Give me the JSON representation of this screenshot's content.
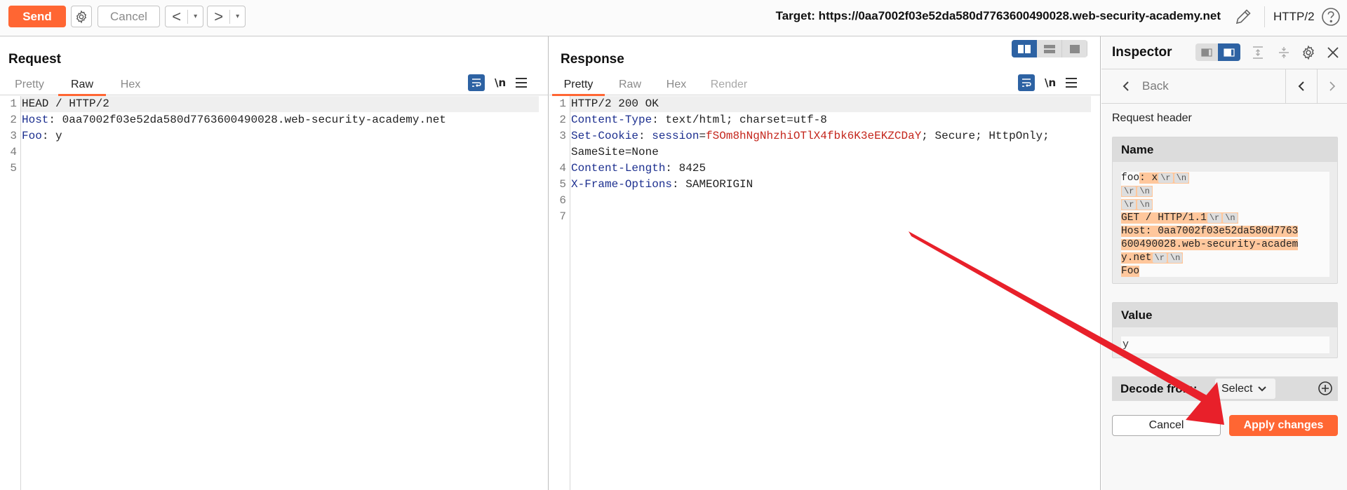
{
  "toolbar": {
    "send_label": "Send",
    "cancel_label": "Cancel",
    "back_glyph": "<",
    "forward_glyph": ">",
    "dropdown_glyph": "▾",
    "target_label": "Target: https://0aa7002f03e52da580d7763600490028.web-security-academy.net",
    "protocol_label": "HTTP/2"
  },
  "request": {
    "title": "Request",
    "tabs": [
      {
        "label": "Pretty",
        "active": false
      },
      {
        "label": "Raw",
        "active": true
      },
      {
        "label": "Hex",
        "active": false
      }
    ],
    "newline_toggle": "\\n",
    "lines": [
      {
        "n": "1",
        "text": "HEAD / HTTP/2"
      },
      {
        "n": "2",
        "key": "Host",
        "value": " 0aa7002f03e52da580d7763600490028.web-security-academy.net"
      },
      {
        "n": "3",
        "key": "Foo",
        "value": " y"
      },
      {
        "n": "4",
        "text": ""
      },
      {
        "n": "5",
        "text": ""
      }
    ]
  },
  "response": {
    "title": "Response",
    "tabs": [
      {
        "label": "Pretty",
        "active": true
      },
      {
        "label": "Raw",
        "active": false
      },
      {
        "label": "Hex",
        "active": false
      },
      {
        "label": "Render",
        "active": false
      }
    ],
    "newline_toggle": "\\n",
    "lines": [
      {
        "n": "1",
        "text": "HTTP/2 200 OK"
      },
      {
        "n": "2",
        "key": "Content-Type",
        "value": " text/html; charset=utf-8"
      },
      {
        "n": "3",
        "key": "Set-Cookie",
        "cookie_name": "session",
        "cookie_value": "fSOm8hNgNhzhiOTlX4fbk6K3eEKZCDaY",
        "rest": "; Secure; HttpOnly;"
      },
      {
        "n": "",
        "text": "SameSite=None"
      },
      {
        "n": "4",
        "key": "Content-Length",
        "value": " 8425"
      },
      {
        "n": "5",
        "key": "X-Frame-Options",
        "value": " SAMEORIGIN"
      },
      {
        "n": "6",
        "text": ""
      },
      {
        "n": "7",
        "text": ""
      }
    ]
  },
  "inspector": {
    "title": "Inspector",
    "back_label": "Back",
    "section_label": "Request header",
    "name_label": "Name",
    "name_lines": [
      {
        "plain": "foo",
        "hl": ": x",
        "esc": [
          "\\r",
          "\\n"
        ]
      },
      {
        "plain": "",
        "hl": "",
        "esc": [
          "\\r",
          "\\n"
        ]
      },
      {
        "plain": "",
        "hl": "",
        "esc": [
          "\\r",
          "\\n"
        ]
      },
      {
        "plain": "",
        "hl": "GET / HTTP/1.1",
        "esc": [
          "\\r",
          "\\n"
        ]
      },
      {
        "plain": "",
        "hl": "Host: 0aa7002f03e52da580d7763",
        "esc": []
      },
      {
        "plain": "",
        "hl": "600490028.web-security-academ",
        "esc": []
      },
      {
        "plain": "",
        "hl": "y.net",
        "esc": [
          "\\r",
          "\\n"
        ]
      },
      {
        "plain": "",
        "hl": "Foo",
        "esc": []
      }
    ],
    "value_label": "Value",
    "value": "y",
    "decode_label": "Decode from:",
    "decode_select": "Select",
    "cancel_label": "Cancel",
    "apply_label": "Apply changes"
  },
  "colors": {
    "accent": "#ff6633",
    "active_blue": "#2d62a3",
    "header_key": "#1c2f8f",
    "cookie_value": "#c4261c",
    "highlight": "#ffc79c",
    "annotation_arrow": "#e8202a"
  }
}
